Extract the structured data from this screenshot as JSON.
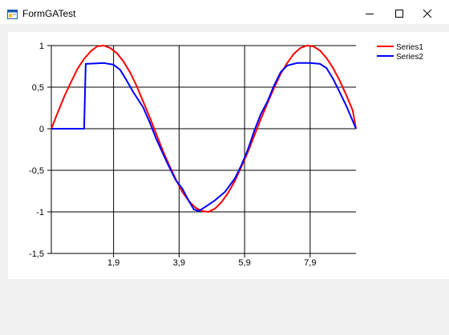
{
  "window": {
    "title": "FormGATest",
    "buttons": {
      "minimize": "minimize-icon",
      "maximize": "maximize-icon",
      "close": "close-icon"
    }
  },
  "chart_data": {
    "type": "line",
    "ylim": [
      -1.5,
      1
    ],
    "xlim": [
      0,
      9.3
    ],
    "y_ticks": [
      1,
      0.5,
      0,
      -0.5,
      -1,
      -1.5
    ],
    "y_tick_labels": [
      "1",
      "0,5",
      "0",
      "-0,5",
      "-1",
      "-1,5"
    ],
    "x_ticks": [
      1.9,
      3.9,
      5.9,
      7.9
    ],
    "x_tick_labels": [
      "1,9",
      "3,9",
      "5,9",
      "7,9"
    ],
    "grid": true,
    "legend_position": "top-right",
    "series": [
      {
        "name": "Series1",
        "color": "#ff0000",
        "points": [
          [
            0,
            0
          ],
          [
            0.2,
            0.2
          ],
          [
            0.4,
            0.39
          ],
          [
            0.6,
            0.56
          ],
          [
            0.8,
            0.72
          ],
          [
            1.0,
            0.84
          ],
          [
            1.2,
            0.93
          ],
          [
            1.4,
            0.99
          ],
          [
            1.6,
            1.0
          ],
          [
            1.8,
            0.97
          ],
          [
            2.0,
            0.91
          ],
          [
            2.2,
            0.81
          ],
          [
            2.4,
            0.68
          ],
          [
            2.6,
            0.52
          ],
          [
            2.8,
            0.33
          ],
          [
            3.0,
            0.14
          ],
          [
            3.2,
            -0.06
          ],
          [
            3.4,
            -0.26
          ],
          [
            3.6,
            -0.44
          ],
          [
            3.8,
            -0.61
          ],
          [
            4.0,
            -0.76
          ],
          [
            4.2,
            -0.87
          ],
          [
            4.4,
            -0.95
          ],
          [
            4.6,
            -0.99
          ],
          [
            4.8,
            -1.0
          ],
          [
            5.0,
            -0.96
          ],
          [
            5.2,
            -0.88
          ],
          [
            5.4,
            -0.77
          ],
          [
            5.6,
            -0.63
          ],
          [
            5.8,
            -0.46
          ],
          [
            6.0,
            -0.28
          ],
          [
            6.2,
            -0.08
          ],
          [
            6.4,
            0.12
          ],
          [
            6.6,
            0.31
          ],
          [
            6.8,
            0.49
          ],
          [
            7.0,
            0.66
          ],
          [
            7.2,
            0.79
          ],
          [
            7.4,
            0.9
          ],
          [
            7.6,
            0.97
          ],
          [
            7.8,
            1.0
          ],
          [
            8.0,
            0.99
          ],
          [
            8.2,
            0.94
          ],
          [
            8.4,
            0.85
          ],
          [
            8.6,
            0.73
          ],
          [
            8.8,
            0.58
          ],
          [
            9.0,
            0.41
          ],
          [
            9.2,
            0.22
          ],
          [
            9.3,
            0.0
          ]
        ]
      },
      {
        "name": "Series2",
        "color": "#0000ff",
        "points": [
          [
            0,
            0
          ],
          [
            1.0,
            0
          ],
          [
            1.05,
            0.78
          ],
          [
            1.6,
            0.79
          ],
          [
            1.9,
            0.77
          ],
          [
            2.1,
            0.71
          ],
          [
            2.3,
            0.58
          ],
          [
            2.5,
            0.44
          ],
          [
            2.8,
            0.26
          ],
          [
            3.0,
            0.08
          ],
          [
            3.2,
            -0.12
          ],
          [
            3.5,
            -0.38
          ],
          [
            3.8,
            -0.62
          ],
          [
            4.0,
            -0.72
          ],
          [
            4.2,
            -0.87
          ],
          [
            4.35,
            -0.97
          ],
          [
            4.5,
            -0.99
          ],
          [
            4.7,
            -0.94
          ],
          [
            5.0,
            -0.86
          ],
          [
            5.3,
            -0.76
          ],
          [
            5.6,
            -0.6
          ],
          [
            5.8,
            -0.44
          ],
          [
            6.0,
            -0.25
          ],
          [
            6.2,
            -0.02
          ],
          [
            6.4,
            0.18
          ],
          [
            6.6,
            0.33
          ],
          [
            6.8,
            0.52
          ],
          [
            7.0,
            0.68
          ],
          [
            7.2,
            0.76
          ],
          [
            7.5,
            0.79
          ],
          [
            7.9,
            0.79
          ],
          [
            8.2,
            0.78
          ],
          [
            8.4,
            0.73
          ],
          [
            8.6,
            0.6
          ],
          [
            8.8,
            0.44
          ],
          [
            9.0,
            0.28
          ],
          [
            9.3,
            0.0
          ]
        ]
      }
    ]
  }
}
